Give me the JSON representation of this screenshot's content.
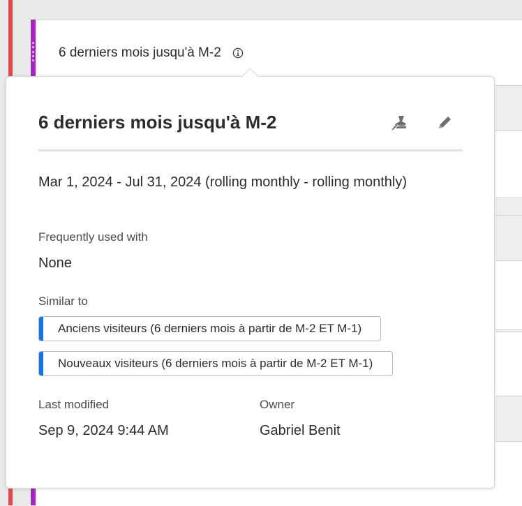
{
  "header": {
    "title": "6 derniers mois jusqu'à M-2",
    "info_icon": "info-icon"
  },
  "popover": {
    "title": "6 derniers mois jusqu'à M-2",
    "actions": [
      {
        "icon": "approve-stamp-icon"
      },
      {
        "icon": "pencil-icon"
      }
    ],
    "date_range": "Mar 1, 2024 - Jul 31, 2024 (rolling monthly - rolling monthly)",
    "frequently_used_label": "Frequently used with",
    "frequently_used_value": "None",
    "similar_label": "Similar to",
    "similar_items": [
      {
        "label": "Anciens visiteurs (6 derniers mois à partir de M-2 ET M-1)"
      },
      {
        "label": "Nouveaux visiteurs (6 derniers mois à partir de M-2 ET M-1)"
      }
    ],
    "last_modified_label": "Last modified",
    "last_modified_value": "Sep 9, 2024 9:44 AM",
    "owner_label": "Owner",
    "owner_value": "Gabriel Benit"
  },
  "colors": {
    "accent_blue": "#1473e6",
    "purple_bar": "#9e2bb3",
    "red_edge": "#e34850"
  }
}
